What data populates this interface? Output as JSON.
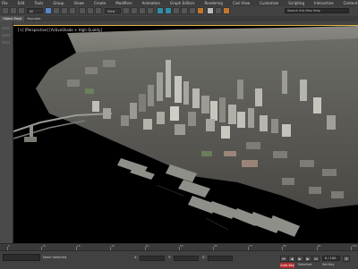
{
  "menu": {
    "items": [
      "File",
      "Edit",
      "Tools",
      "Group",
      "Views",
      "Create",
      "Modifiers",
      "Animation",
      "Graph Editors",
      "Rendering",
      "Civil View",
      "Customize",
      "Scripting",
      "Interactive",
      "Content",
      "Substance",
      "Arnold",
      "Help"
    ]
  },
  "toolbar": {
    "filter_dropdown": "All",
    "view_dropdown": "View",
    "search_placeholder": "Search 3ds Max Help"
  },
  "ribbon": {
    "tabs": [
      "Object Paint",
      "Populate"
    ]
  },
  "viewport": {
    "label": "[+] [Perspective] [ActiveShade + High Quality]"
  },
  "timeline": {
    "ticks": [
      "0",
      "10",
      "20",
      "30",
      "40",
      "50",
      "60",
      "70",
      "80",
      "90",
      "100"
    ]
  },
  "status": {
    "selection": "None Selected",
    "x_label": "X:",
    "y_label": "Y:",
    "z_label": "Z:",
    "auto_key": "Auto Key",
    "selected_dropdown": "Selected",
    "set_key": "Set Key",
    "key_filters": "Key Filters...",
    "frame_counter": "0 / 100"
  },
  "colors": {
    "viewport_border": "#e1b43c",
    "autokey": "#b52b2b",
    "accent": "#5a86c8"
  }
}
